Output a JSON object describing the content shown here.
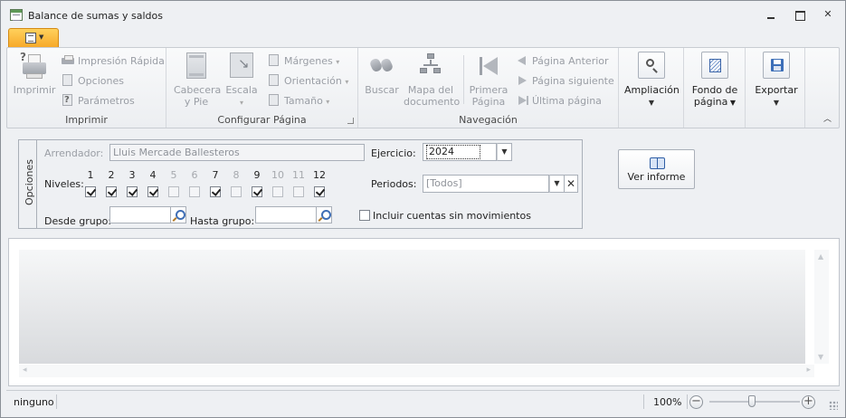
{
  "window": {
    "title": "Balance de sumas y saldos"
  },
  "ribbon": {
    "groups": {
      "imprimir": {
        "label": "Imprimir",
        "print_label": "Imprimir",
        "quick_print_label": "Impresión Rápida",
        "options_label": "Opciones",
        "parameters_label": "Parámetros"
      },
      "configurar": {
        "label": "Configurar Página",
        "header_footer_label_1": "Cabecera",
        "header_footer_label_2": "y Pie",
        "scale_label": "Escala",
        "margins_label": "Márgenes",
        "orientation_label": "Orientación",
        "size_label": "Tamaño"
      },
      "navegacion": {
        "label": "Navegación",
        "search_label": "Buscar",
        "doc_map_label_1": "Mapa del",
        "doc_map_label_2": "documento",
        "first_page_label_1": "Primera",
        "first_page_label_2": "Página",
        "prev_page_label": "Página Anterior",
        "next_page_label": "Página siguiente",
        "last_page_label": "Última página"
      }
    },
    "zoom_label": "Ampliación",
    "page_bg_label_1": "Fondo de",
    "page_bg_label_2": "página",
    "export_label": "Exportar"
  },
  "options": {
    "tab_label": "Opciones",
    "landlord_label": "Arrendador:",
    "landlord_value": "Lluis Mercade Ballesteros",
    "levels_label": "Niveles:",
    "levels": [
      {
        "num": "1",
        "checked": true,
        "enabled": true
      },
      {
        "num": "2",
        "checked": true,
        "enabled": true
      },
      {
        "num": "3",
        "checked": true,
        "enabled": true
      },
      {
        "num": "4",
        "checked": true,
        "enabled": true
      },
      {
        "num": "5",
        "checked": false,
        "enabled": false
      },
      {
        "num": "6",
        "checked": false,
        "enabled": false
      },
      {
        "num": "7",
        "checked": true,
        "enabled": true
      },
      {
        "num": "8",
        "checked": false,
        "enabled": false
      },
      {
        "num": "9",
        "checked": true,
        "enabled": true
      },
      {
        "num": "10",
        "checked": false,
        "enabled": false
      },
      {
        "num": "11",
        "checked": false,
        "enabled": false
      },
      {
        "num": "12",
        "checked": true,
        "enabled": true
      }
    ],
    "from_group_label": "Desde grupo:",
    "from_group_value": "",
    "to_group_label": "Hasta grupo:",
    "to_group_value": "",
    "fiscal_year_label": "Ejercicio:",
    "fiscal_year_value": "2024",
    "periods_label": "Periodos:",
    "periods_value": "[Todos]",
    "include_empty_label": "Incluir cuentas sin movimientos",
    "include_empty_checked": false
  },
  "view_report_label": "Ver informe",
  "statusbar": {
    "status": "ninguno",
    "zoom_label": "100%",
    "zoom_level_percent": 100
  }
}
